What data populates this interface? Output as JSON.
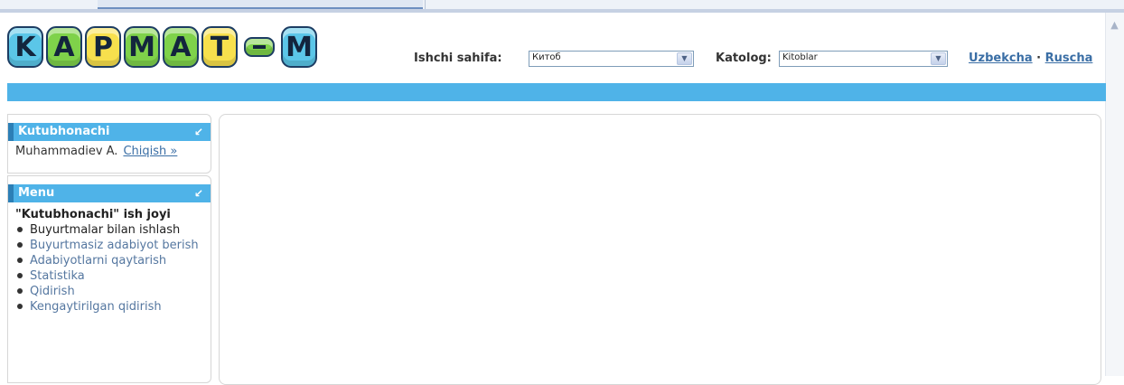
{
  "logo": {
    "letters": [
      "K",
      "A",
      "P",
      "M",
      "A",
      "T",
      "M"
    ]
  },
  "header": {
    "workpage_label": "Ishchi sahifa:",
    "workpage_value": "Китоб",
    "catalog_label": "Katolog:",
    "catalog_value": "Kitoblar",
    "lang_uz": "Uzbekcha",
    "lang_sep": "·",
    "lang_ru": "Ruscha"
  },
  "user_box": {
    "title": "Kutubhonachi",
    "user_name": "Muhammadiev A.",
    "logout": "Chiqish »"
  },
  "menu_box": {
    "title": "Menu",
    "section_title": "\"Kutubhonachi\" ish joyi",
    "items": [
      "Buyurtmalar bilan ishlash",
      "Buyurtmasiz adabiyot berish",
      "Adabiyotlarni qaytarish",
      "Statistika",
      "Qidirish",
      "Kengaytirilgan qidirish"
    ]
  },
  "colors": {
    "band": "#4fb3e8",
    "link": "#3a6ea5"
  }
}
